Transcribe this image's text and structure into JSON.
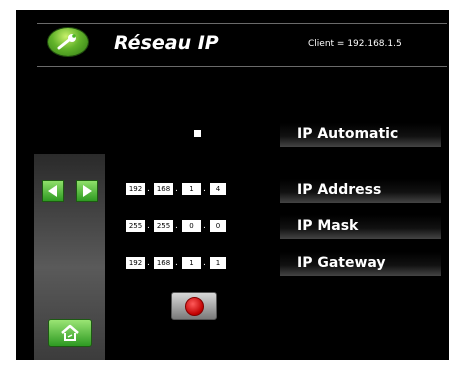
{
  "header": {
    "title": "Réseau IP",
    "client_text": "Client = 192.168.1.5"
  },
  "icons": {
    "logo": "wrench-icon",
    "prev": "arrow-left-icon",
    "next": "arrow-right-icon",
    "home": "home-icon",
    "record": "record-icon"
  },
  "colors": {
    "background": "#000000",
    "accent_green": "#4cb826",
    "record_red": "#e00000"
  },
  "settings": {
    "automatic": {
      "label": "IP Automatic"
    },
    "address": {
      "label": "IP Address",
      "octets": [
        "192",
        "168",
        "1",
        "4"
      ]
    },
    "mask": {
      "label": "IP Mask",
      "octets": [
        "255",
        "255",
        "0",
        "0"
      ]
    },
    "gateway": {
      "label": "IP Gateway",
      "octets": [
        "192",
        "168",
        "1",
        "1"
      ]
    }
  },
  "separator": "."
}
